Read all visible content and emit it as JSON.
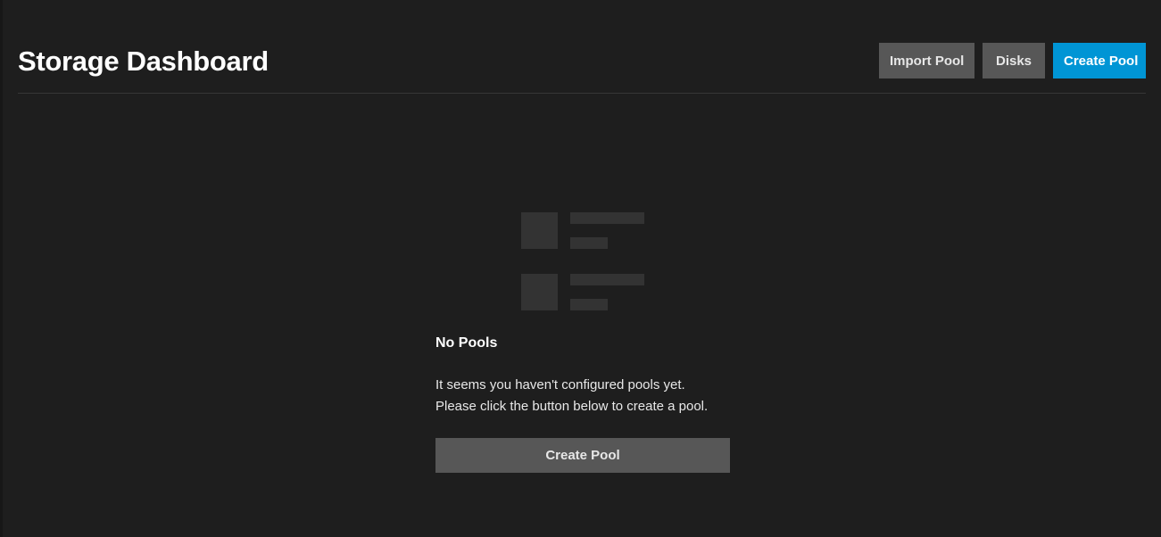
{
  "header": {
    "title": "Storage Dashboard",
    "actions": {
      "import_label": "Import Pool",
      "disks_label": "Disks",
      "create_label": "Create Pool"
    }
  },
  "empty_state": {
    "icon": "storage-placeholder-icon",
    "title": "No Pools",
    "message_line_1": "It seems you haven't configured pools yet.",
    "message_line_2": "Please click the button below to create a pool.",
    "button_label": "Create Pool"
  },
  "colors": {
    "background": "#1e1e1e",
    "primary_button": "#0095d5",
    "secondary_button": "#575757",
    "placeholder_icon": "#333333"
  }
}
